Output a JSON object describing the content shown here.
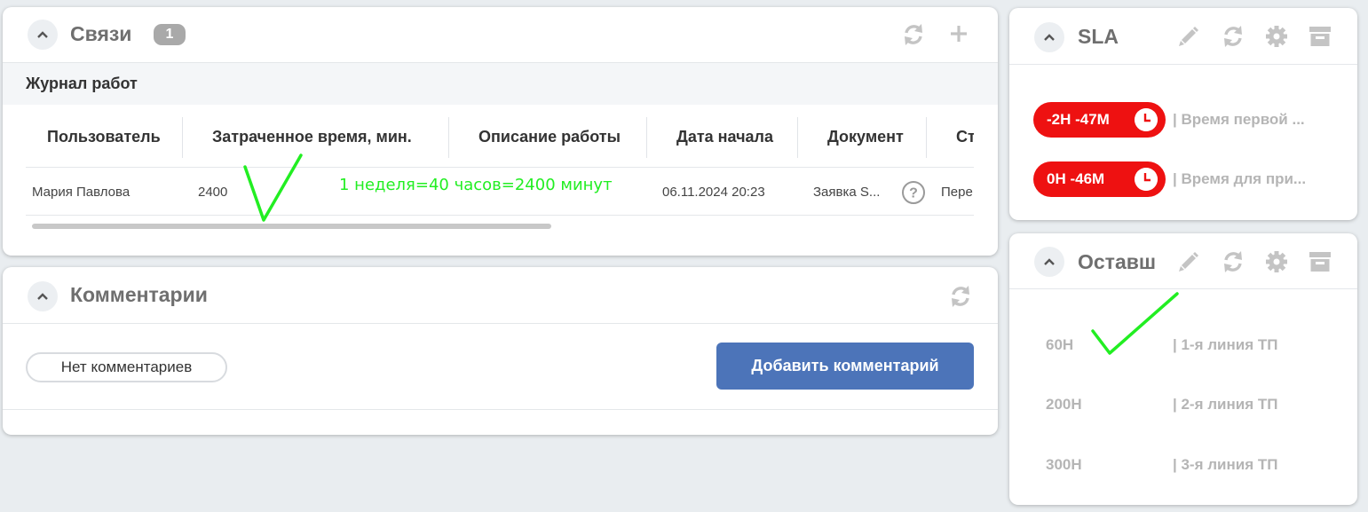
{
  "links_card": {
    "title": "Связи",
    "count": "1",
    "section_title": "Журнал работ",
    "columns": [
      "Пользователь",
      "Затраченное время, мин.",
      "Описание работы",
      "Дата начала",
      "Документ",
      "Ст"
    ],
    "row": {
      "user": "Мария Павлова",
      "time": "2400",
      "description": "",
      "start_date": "06.11.2024 20:23",
      "document": "Заявка S...",
      "status": "Пере"
    },
    "annotation": "1 неделя=40 часов=2400 минут"
  },
  "comments_card": {
    "title": "Комментарии",
    "empty_label": "Нет комментариев",
    "add_button": "Добавить комментарий"
  },
  "sla_card": {
    "title": "SLA",
    "items": [
      {
        "value": "-2H -47M",
        "label": "| Время первой ..."
      },
      {
        "value": "0H -46M",
        "label": "| Время для при..."
      }
    ]
  },
  "remaining_card": {
    "title": "Оставш",
    "items": [
      {
        "value": "60H",
        "label": "| 1-я линия ТП"
      },
      {
        "value": "200H",
        "label": "| 2-я линия ТП"
      },
      {
        "value": "300H",
        "label": "| 3-я линия ТП"
      }
    ]
  },
  "colors": {
    "accent_button": "#4c74b9",
    "sla_red": "#ee1111",
    "annotation_green": "#22ee22"
  },
  "icons": [
    "chevron-up-icon",
    "refresh-icon",
    "plus-icon",
    "pencil-icon",
    "gear-icon",
    "archive-icon",
    "help-icon",
    "clock-icon"
  ]
}
